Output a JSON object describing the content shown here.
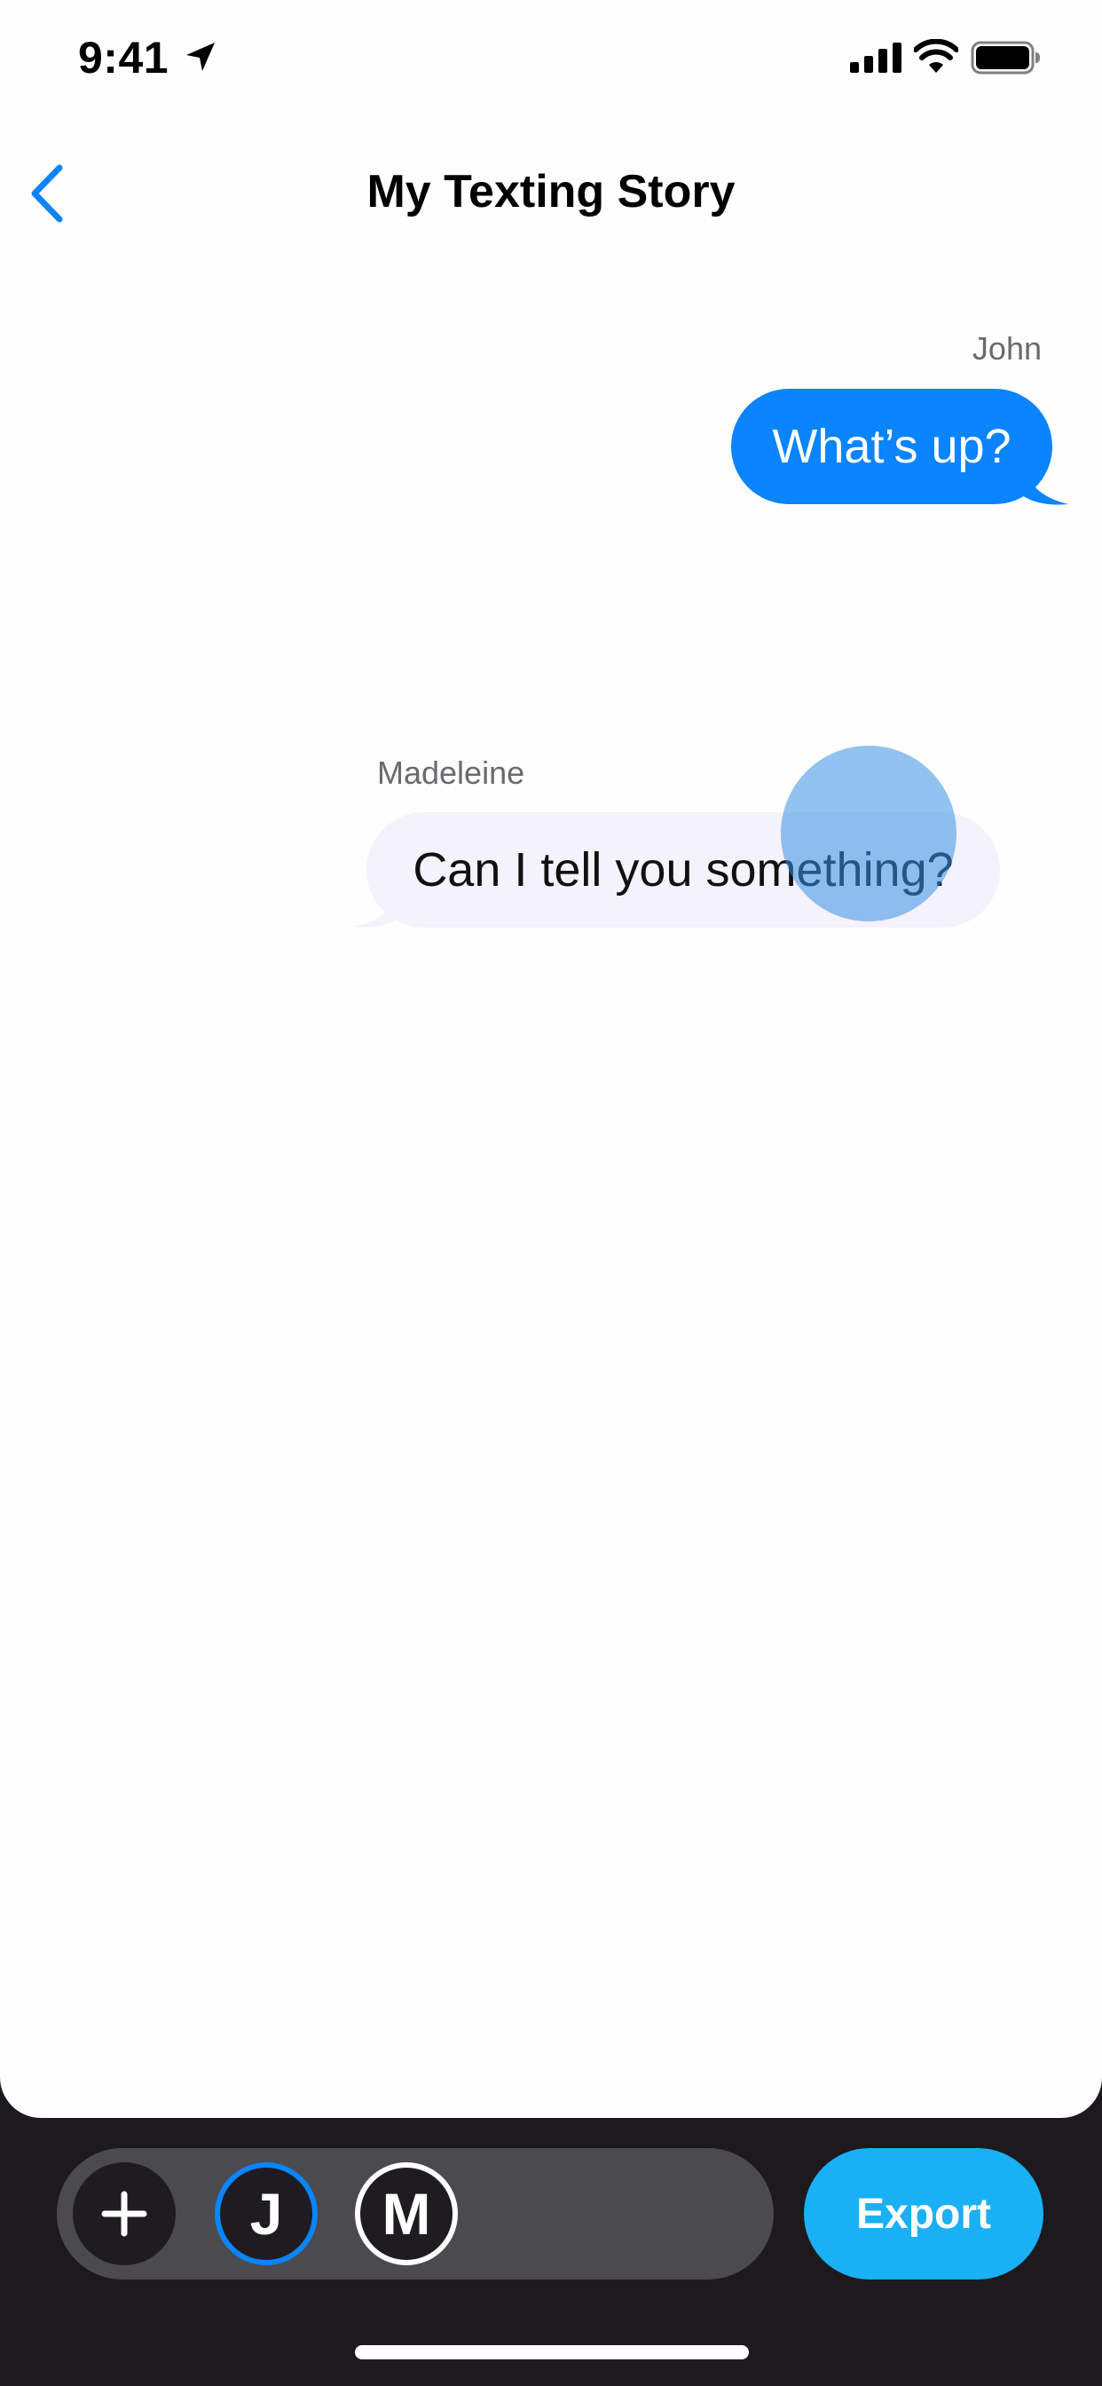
{
  "status_bar": {
    "time": "9:41",
    "icons": [
      "location-arrow-icon",
      "cellular-signal-icon",
      "wifi-icon",
      "battery-icon"
    ]
  },
  "nav": {
    "back_icon": "chevron-left-icon",
    "title": "My Texting Story"
  },
  "messages": [
    {
      "sender": "John",
      "text": "What’s up?",
      "direction": "outgoing",
      "bubble_color": "#0a84ff"
    },
    {
      "sender": "Madeleine",
      "text": "Can I tell you something?",
      "direction": "incoming",
      "bubble_color": "#f4f2fa"
    }
  ],
  "toolbar": {
    "add_icon": "plus-icon",
    "characters": [
      {
        "initial": "J",
        "selected": true,
        "ring_color": "#0a84ff"
      },
      {
        "initial": "M",
        "selected": false,
        "ring_color": "#ffffff"
      }
    ],
    "export_label": "Export"
  },
  "colors": {
    "accent": "#0a84ff",
    "export": "#1ab0f5",
    "toolbar_background": "#1c1a1f"
  }
}
